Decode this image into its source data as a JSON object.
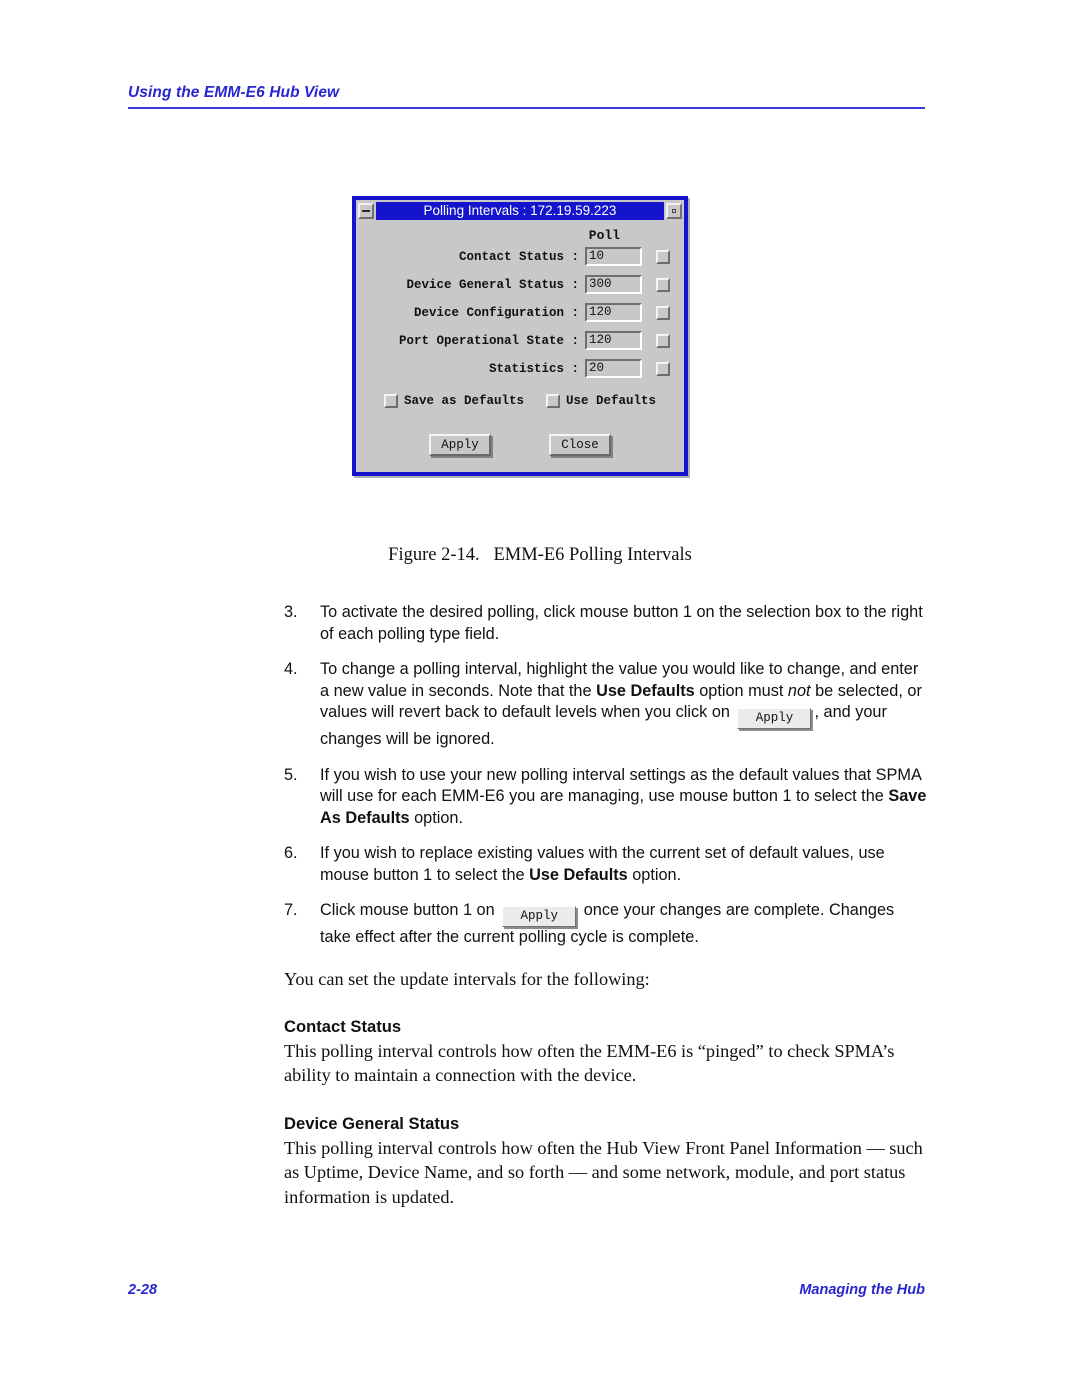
{
  "header": {
    "title": "Using the EMM-E6 Hub View"
  },
  "dialog": {
    "title": "Polling Intervals : 172.19.59.223",
    "minimize_label": "minimize",
    "maximize_label": "maximize",
    "poll_column_header": "Poll",
    "fields": [
      {
        "label": "Contact Status :",
        "value": "10",
        "poll_checked": false
      },
      {
        "label": "Device General Status :",
        "value": "300",
        "poll_checked": false
      },
      {
        "label": "Device Configuration :",
        "value": "120",
        "poll_checked": false
      },
      {
        "label": "Port Operational State :",
        "value": "120",
        "poll_checked": false
      },
      {
        "label": "Statistics :",
        "value": "20",
        "poll_checked": false
      }
    ],
    "defaults": [
      {
        "label": "Save as Defaults",
        "checked": false
      },
      {
        "label": "Use Defaults",
        "checked": false
      }
    ],
    "buttons": {
      "apply": "Apply",
      "close": "Close"
    },
    "colors": {
      "titlebar_blue": "#1414cc",
      "window_border": "#1414cc",
      "face_gray": "#c8c8c8"
    }
  },
  "figure": {
    "caption_number": "Figure 2-14.",
    "caption_text": "EMM-E6 Polling Intervals"
  },
  "steps": [
    {
      "number": "3.",
      "parts": [
        {
          "type": "text",
          "text": "To activate the desired polling, click mouse button 1 on the selection box to the right of each polling type field."
        }
      ]
    },
    {
      "number": "4.",
      "parts": [
        {
          "type": "text",
          "text": "To change a polling interval, highlight the value you would like to change, and enter a new value in seconds. Note that the "
        },
        {
          "type": "bold",
          "text": "Use Defaults"
        },
        {
          "type": "text",
          "text": " option must "
        },
        {
          "type": "italic",
          "text": "not"
        },
        {
          "type": "text",
          "text": " be selected, or values will revert back to default levels when you click on "
        },
        {
          "type": "button",
          "text": "Apply"
        },
        {
          "type": "text",
          "text": ", and your changes will be ignored."
        }
      ]
    },
    {
      "number": "5.",
      "parts": [
        {
          "type": "text",
          "text": "If you wish to use your new polling interval settings as the default values that SPMA will use for each EMM-E6 you are managing, use mouse button 1 to select the "
        },
        {
          "type": "bold",
          "text": "Save As Defaults"
        },
        {
          "type": "text",
          "text": " option."
        }
      ]
    },
    {
      "number": "6.",
      "parts": [
        {
          "type": "text",
          "text": "If you wish to replace existing values with the current set of default values, use mouse button 1 to select the "
        },
        {
          "type": "bold",
          "text": "Use Defaults"
        },
        {
          "type": "text",
          "text": " option."
        }
      ]
    },
    {
      "number": "7.",
      "parts": [
        {
          "type": "text",
          "text": "Click mouse button 1 on "
        },
        {
          "type": "button",
          "text": "Apply"
        },
        {
          "type": "text",
          "text": " once your changes are complete. Changes take effect after the current polling cycle is complete."
        }
      ]
    }
  ],
  "lead_paragraph": "You can set the update intervals for the following:",
  "sections": [
    {
      "heading": "Contact Status",
      "body": "This polling interval controls how often the EMM-E6 is “pinged” to check SPMA’s ability to maintain a connection with the device."
    },
    {
      "heading": "Device General Status",
      "body": "This polling interval controls how often the Hub View Front Panel Information — such as Uptime, Device Name, and so forth — and some network, module, and port status information is updated."
    }
  ],
  "footer": {
    "page_number": "2-28",
    "section_title": "Managing the Hub"
  }
}
